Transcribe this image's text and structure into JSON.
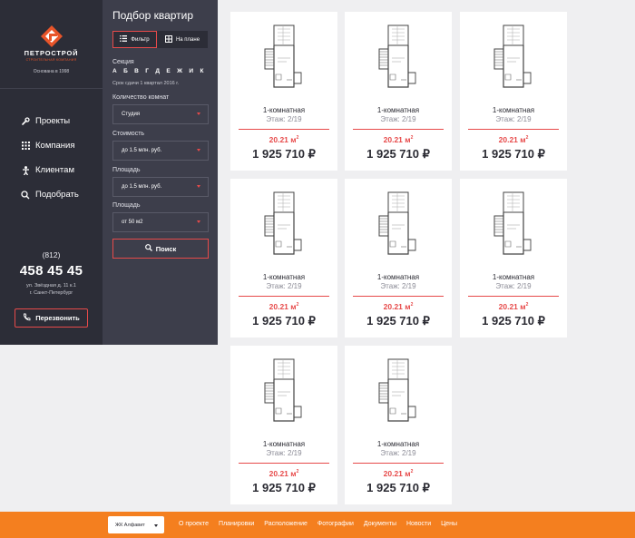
{
  "brand": {
    "name": "ПЕТРОСТРОЙ",
    "subtitle": "СТРОИТЕЛЬНАЯ КОМПАНИЯ",
    "founded": "Основана в 1998",
    "accent_color": "#e8552a",
    "logo_icon": "logo-mark"
  },
  "nav": [
    {
      "label": "Проекты",
      "icon": "wrench-icon"
    },
    {
      "label": "Компания",
      "icon": "grid-icon"
    },
    {
      "label": "Клиентам",
      "icon": "person-icon"
    },
    {
      "label": "Подобрать",
      "icon": "search-icon"
    }
  ],
  "contacts": {
    "code": "(812)",
    "phone": "458 45 45",
    "address_line1": "ул. Звёздная д. 11 к.1",
    "address_line2": "г. Санкт-Петербург",
    "callback_label": "Перезвонить"
  },
  "filter": {
    "title": "Подбор квартир",
    "tab_filter": "Фильтр",
    "tab_plan": "На плане",
    "section_label": "Секция",
    "sections": "А Б В Г Д Е Ж И К",
    "deadline": "Срок сдачи 1 квартал 2016 г.",
    "rooms_label": "Количество комнат",
    "rooms_value": "Студия",
    "cost_label": "Стоимость",
    "cost_value": "до 1.5 млн. руб.",
    "area_label": "Площадь",
    "area_value": "до 1.5 млн. руб.",
    "area2_label": "Площадь",
    "area2_value": "от 50 м2",
    "search_label": "Поиск"
  },
  "cards": [
    {
      "rooms": "1-комнатная",
      "floor": "Этаж: 2/19",
      "area": "20.21 м",
      "area_sup": "2",
      "price": "1 925 710 ₽"
    },
    {
      "rooms": "1-комнатная",
      "floor": "Этаж: 2/19",
      "area": "20.21 м",
      "area_sup": "2",
      "price": "1 925 710 ₽"
    },
    {
      "rooms": "1-комнатная",
      "floor": "Этаж: 2/19",
      "area": "20.21 м",
      "area_sup": "2",
      "price": "1 925 710 ₽"
    },
    {
      "rooms": "1-комнатная",
      "floor": "Этаж: 2/19",
      "area": "20.21 м",
      "area_sup": "2",
      "price": "1 925 710 ₽"
    },
    {
      "rooms": "1-комнатная",
      "floor": "Этаж: 2/19",
      "area": "20.21 м",
      "area_sup": "2",
      "price": "1 925 710 ₽"
    },
    {
      "rooms": "1-комнатная",
      "floor": "Этаж: 2/19",
      "area": "20.21 м",
      "area_sup": "2",
      "price": "1 925 710 ₽"
    },
    {
      "rooms": "1-комнатная",
      "floor": "Этаж: 2/19",
      "area": "20.21 м",
      "area_sup": "2",
      "price": "1 925 710 ₽"
    },
    {
      "rooms": "1-комнатная",
      "floor": "Этаж: 2/19",
      "area": "20.21 м",
      "area_sup": "2",
      "price": "1 925 710 ₽"
    }
  ],
  "footer": {
    "complex": "ЖК Алфавит",
    "links": [
      "О проекте",
      "Планировки",
      "Расположение",
      "Фотографии",
      "Документы",
      "Новости",
      "Цены"
    ],
    "color": "#f47f1f"
  }
}
